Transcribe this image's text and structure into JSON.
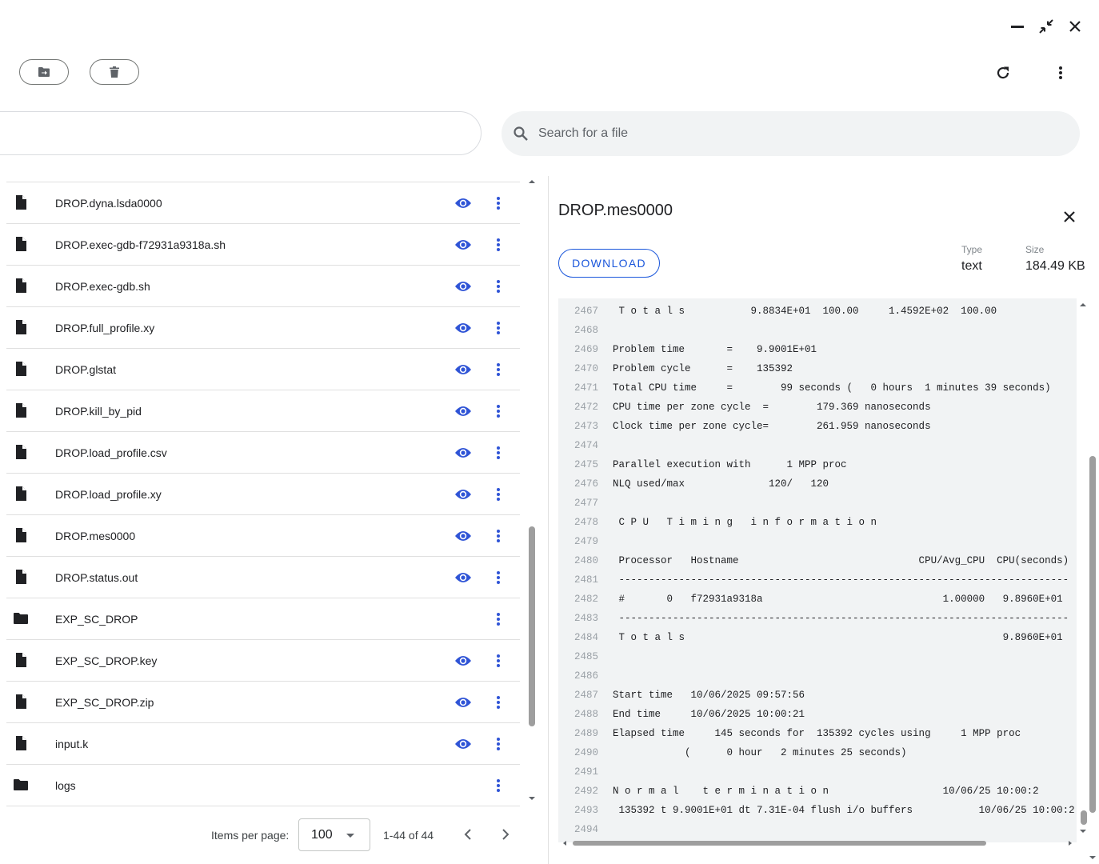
{
  "search": {
    "placeholder": "Search for a file"
  },
  "files": [
    {
      "name": "DROP.dyna.lsda0000",
      "kind": "file",
      "previewable": true
    },
    {
      "name": "DROP.exec-gdb-f72931a9318a.sh",
      "kind": "file",
      "previewable": true
    },
    {
      "name": "DROP.exec-gdb.sh",
      "kind": "file",
      "previewable": true
    },
    {
      "name": "DROP.full_profile.xy",
      "kind": "file",
      "previewable": true
    },
    {
      "name": "DROP.glstat",
      "kind": "file",
      "previewable": true
    },
    {
      "name": "DROP.kill_by_pid",
      "kind": "file",
      "previewable": true
    },
    {
      "name": "DROP.load_profile.csv",
      "kind": "file",
      "previewable": true
    },
    {
      "name": "DROP.load_profile.xy",
      "kind": "file",
      "previewable": true
    },
    {
      "name": "DROP.mes0000",
      "kind": "file",
      "previewable": true
    },
    {
      "name": "DROP.status.out",
      "kind": "file",
      "previewable": true
    },
    {
      "name": "EXP_SC_DROP",
      "kind": "folder",
      "previewable": false
    },
    {
      "name": "EXP_SC_DROP.key",
      "kind": "file",
      "previewable": true
    },
    {
      "name": "EXP_SC_DROP.zip",
      "kind": "file",
      "previewable": true
    },
    {
      "name": "input.k",
      "kind": "file",
      "previewable": true
    },
    {
      "name": "logs",
      "kind": "folder",
      "previewable": false
    }
  ],
  "pagination": {
    "items_per_page_label": "Items per page:",
    "items_per_page_value": "100",
    "range": "1-44 of 44"
  },
  "preview": {
    "title": "DROP.mes0000",
    "download_label": "DOWNLOAD",
    "type_label": "Type",
    "type_value": "text",
    "size_label": "Size",
    "size_value": "184.49 KB",
    "lines": [
      {
        "n": "2467",
        "t": " T o t a l s           9.8834E+01  100.00     1.4592E+02  100.00"
      },
      {
        "n": "2468",
        "t": ""
      },
      {
        "n": "2469",
        "t": "Problem time       =    9.9001E+01"
      },
      {
        "n": "2470",
        "t": "Problem cycle      =    135392"
      },
      {
        "n": "2471",
        "t": "Total CPU time     =        99 seconds (   0 hours  1 minutes 39 seconds)"
      },
      {
        "n": "2472",
        "t": "CPU time per zone cycle  =        179.369 nanoseconds"
      },
      {
        "n": "2473",
        "t": "Clock time per zone cycle=        261.959 nanoseconds"
      },
      {
        "n": "2474",
        "t": ""
      },
      {
        "n": "2475",
        "t": "Parallel execution with      1 MPP proc"
      },
      {
        "n": "2476",
        "t": "NLQ used/max              120/   120"
      },
      {
        "n": "2477",
        "t": ""
      },
      {
        "n": "2478",
        "t": " C P U   T i m i n g   i n f o r m a t i o n"
      },
      {
        "n": "2479",
        "t": ""
      },
      {
        "n": "2480",
        "t": " Processor   Hostname                              CPU/Avg_CPU  CPU(seconds)"
      },
      {
        "n": "2481",
        "t": " ---------------------------------------------------------------------------"
      },
      {
        "n": "2482",
        "t": " #       0   f72931a9318a                              1.00000   9.8960E+01"
      },
      {
        "n": "2483",
        "t": " ---------------------------------------------------------------------------"
      },
      {
        "n": "2484",
        "t": " T o t a l s                                                     9.8960E+01"
      },
      {
        "n": "2485",
        "t": ""
      },
      {
        "n": "2486",
        "t": ""
      },
      {
        "n": "2487",
        "t": "Start time   10/06/2025 09:57:56"
      },
      {
        "n": "2488",
        "t": "End time     10/06/2025 10:00:21"
      },
      {
        "n": "2489",
        "t": "Elapsed time     145 seconds for  135392 cycles using     1 MPP proc"
      },
      {
        "n": "2490",
        "t": "            (      0 hour   2 minutes 25 seconds)"
      },
      {
        "n": "2491",
        "t": ""
      },
      {
        "n": "2492",
        "t": "N o r m a l    t e r m i n a t i o n                   10/06/25 10:00:2"
      },
      {
        "n": "2493",
        "t": " 135392 t 9.9001E+01 dt 7.31E-04 flush i/o buffers           10/06/25 10:00:2"
      },
      {
        "n": "2494",
        "t": ""
      }
    ]
  },
  "colors": {
    "accent": "#1a56db",
    "eye_icon": "#2f54d6",
    "text": "#202124",
    "code_bg": "#f1f3f4"
  }
}
